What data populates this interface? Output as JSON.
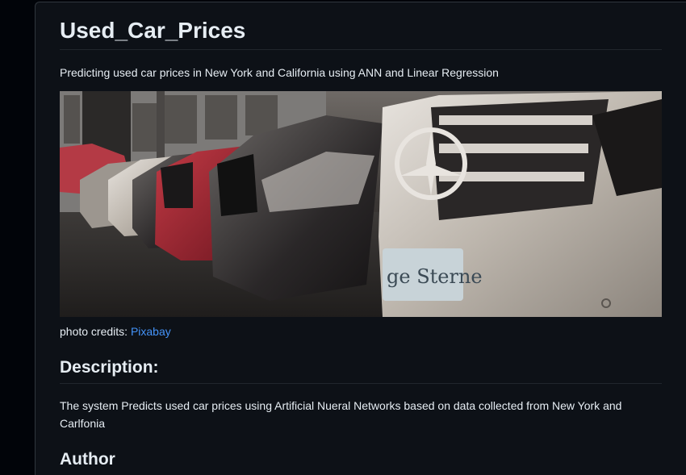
{
  "readme": {
    "title": "Used_Car_Prices",
    "subtitle": "Predicting used car prices in New York and California using ANN and Linear Regression",
    "photo_credits_label": "photo credits: ",
    "photo_credits_link": "Pixabay",
    "description_heading": "Description:",
    "description_text": "The system Predicts used car prices using Artificial Nueral Networks based on data collected from New York and Carlfonia",
    "author_heading": "Author",
    "hero_plate_text": "ge Sterne"
  }
}
